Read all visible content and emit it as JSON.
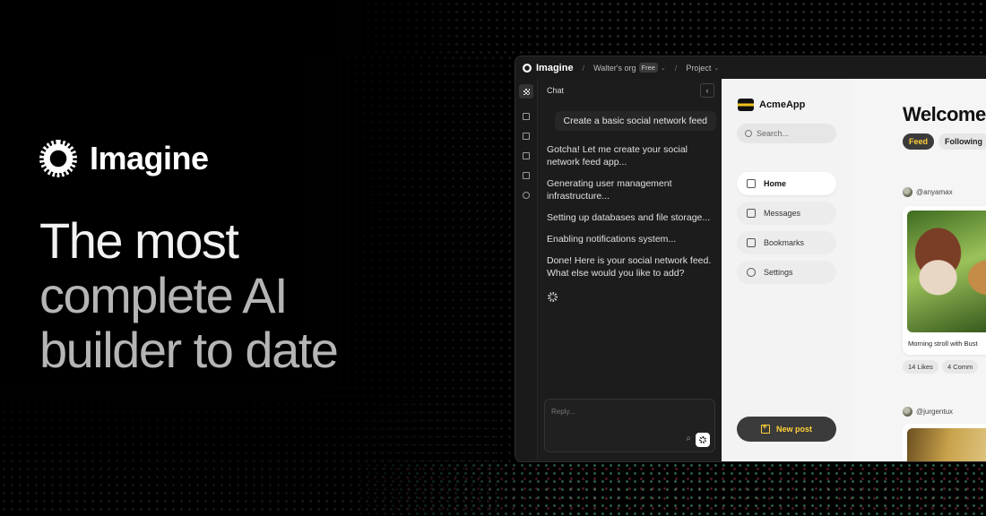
{
  "hero": {
    "brand": "Imagine",
    "headline_line1": "The most",
    "headline_line2": "complete AI",
    "headline_line3": "builder to date"
  },
  "window": {
    "app_name": "Imagine",
    "org": "Walter's org",
    "plan_badge": "Free",
    "project": "Project",
    "separator": "/"
  },
  "rail_icons": [
    "grid-icon",
    "users-icon",
    "database-icon",
    "messages-icon",
    "folder-icon",
    "settings-icon"
  ],
  "chat": {
    "title": "Chat",
    "user_message": "Create a basic social network feed",
    "bot_messages": [
      "Gotcha! Let me create your social network feed app...",
      "Generating user management infrastructure...",
      "Setting up databases and file storage...",
      "Enabling notifications system...",
      "Done! Here is your social network feed. What else would you like to add?"
    ],
    "reply_placeholder": "Reply..."
  },
  "app": {
    "name": "AcmeApp",
    "search_placeholder": "Search...",
    "nav": [
      {
        "label": "Home",
        "active": true
      },
      {
        "label": "Messages"
      },
      {
        "label": "Bookmarks"
      },
      {
        "label": "Settings"
      }
    ],
    "new_post": "New post",
    "accent": "#ffd13a"
  },
  "feed": {
    "welcome": "Welcome",
    "tabs": [
      "Feed",
      "Following"
    ],
    "post1": {
      "author": "@anyamax",
      "caption": "Morning stroll with Bust",
      "likes": "14 Likes",
      "comments": "4 Comm"
    },
    "post2": {
      "author": "@jurgentux"
    }
  }
}
